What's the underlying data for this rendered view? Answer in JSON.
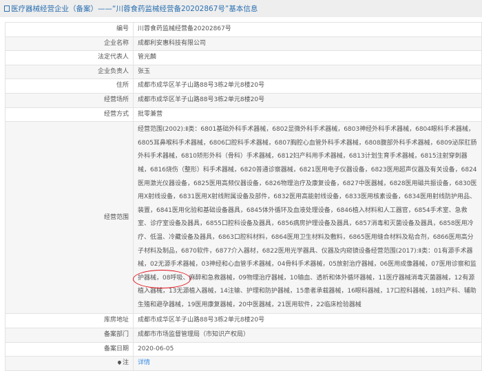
{
  "header": {
    "title": "医疗器械经营企业（备案）——“川蓉食药监械经营备20202867号”基本信息"
  },
  "rows": [
    {
      "label": "编号",
      "value": "川蓉食药监械经营备20202867号"
    },
    {
      "label": "企业名称",
      "value": "成都利安惠科技有限公司"
    },
    {
      "label": "法定代表人",
      "value": "管光麟"
    },
    {
      "label": "企业负责人",
      "value": "张玉"
    },
    {
      "label": "住所",
      "value": "成都市成华区羊子山路88号3栋2单元8楼20号"
    },
    {
      "label": "经营场所",
      "value": "成都市成华区羊子山路88号3栋2单元8楼20号"
    },
    {
      "label": "经营方式",
      "value": "批零兼营"
    },
    {
      "label": "经营范围",
      "value": "经营范围(2002):Ⅱ类：6801基础外科手术器械，6802显微外科手术器械，6803神经外科手术器械，6804眼科手术器械，6805耳鼻喉科手术器械，6806口腔科手术器械，6807胸腔心血管外科手术器械，6808腹部外科手术器械，6809泌尿肛肠外科手术器械，6810矫形外科（骨科）手术器械，6812妇产科用手术器械，6813计划生育手术器械，6815注射穿刺器械，6816烧伤（整形）科手术器械，6820普通诊察器械，6821医用电子仪器设备，6823医用超声仪器及有关设备，6824医用激光仪器设备，6825医用高频仪器设备，6826物理治疗及康复设备，6827中医器械，6828医用磁共振设备，6830医用X射线设备，6831医用X射线附属设备及部件，6832医用高能射线设备，6833医用核素设备，6834医用射线防护用品、装置，6841医用化验和基础设备器具，6845体外循环及血液处理设备，6846植入材料和人工器官，6854手术室、急救室、诊疗室设备及器具，6855口腔科设备及器具，6856病房护理设备及器具，6857消毒和灭菌设备及器具，6858医用冷疗、低温、冷藏设备及器具，6863口腔科材料，6864医用卫生材料及敷料，6865医用缝合材料及粘合剂，6866医用高分子材料及制品，6870软件，6877介入器材，6822医用光学器具、仪器及内窥镜设备经营范围(2017):Ⅱ类：01有源手术器械，02无源手术器械，03神经和心血管手术器械，04骨科手术器械，05放射治疗器械，06医用成像器械，07医用诊察和监护器械，08呼吸、麻醉和急救器械，09物理治疗器械，10输血、透析和体外循环器械，11医疗器械消毒灭菌器械，12有源植入器械，13无源植入器械，14注输、护理和防护器械，15患者承载器械，16眼科器械，17口腔科器械，18妇产科、辅助生殖和避孕器械，19医用康复器械，20中医器械，21医用软件，22临床检验器械"
    },
    {
      "label": "库房地址",
      "value": "成都市成华区羊子山路88号3栋2单元8楼20号"
    },
    {
      "label": "备案部门",
      "value": "成都市市场监督管理局（市知识产权局）"
    },
    {
      "label": "备案日期",
      "value": "2020-06-05"
    },
    {
      "label": "注",
      "value": "详情"
    }
  ],
  "colors": {
    "title": "#2a6fb0",
    "link": "#3a8ee6",
    "annotation": "#e0101a"
  }
}
